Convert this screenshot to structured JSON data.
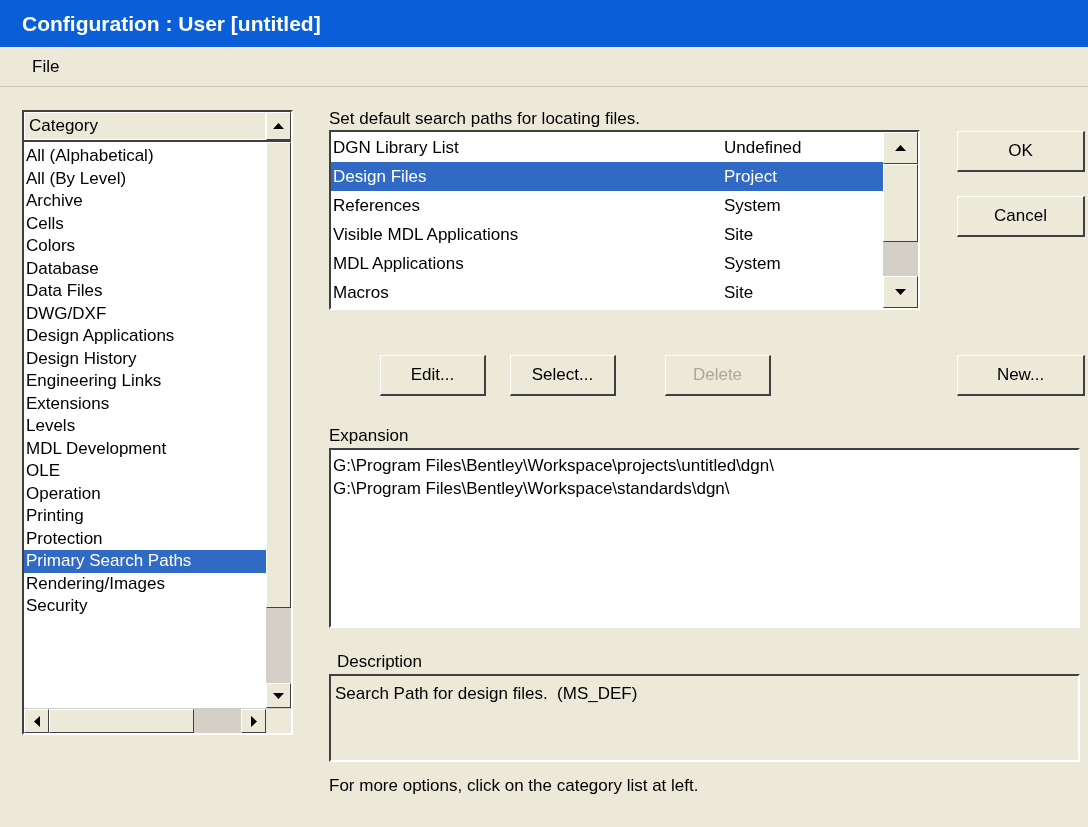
{
  "window": {
    "title": "Configuration : User [untitled]"
  },
  "menu": [
    {
      "label": "File"
    }
  ],
  "category_list": {
    "header": "Category",
    "items": [
      {
        "label": "All (Alphabetical)",
        "selected": false
      },
      {
        "label": "All (By Level)",
        "selected": false
      },
      {
        "label": "Archive",
        "selected": false
      },
      {
        "label": "Cells",
        "selected": false
      },
      {
        "label": "Colors",
        "selected": false
      },
      {
        "label": "Database",
        "selected": false
      },
      {
        "label": "Data Files",
        "selected": false
      },
      {
        "label": "DWG/DXF",
        "selected": false
      },
      {
        "label": "Design Applications",
        "selected": false
      },
      {
        "label": "Design History",
        "selected": false
      },
      {
        "label": "Engineering Links",
        "selected": false
      },
      {
        "label": "Extensions",
        "selected": false
      },
      {
        "label": "Levels",
        "selected": false
      },
      {
        "label": "MDL Development",
        "selected": false
      },
      {
        "label": "OLE",
        "selected": false
      },
      {
        "label": "Operation",
        "selected": false
      },
      {
        "label": "Printing",
        "selected": false
      },
      {
        "label": "Protection",
        "selected": false
      },
      {
        "label": "Primary Search Paths",
        "selected": true
      },
      {
        "label": "Rendering/Images",
        "selected": false
      },
      {
        "label": "Security",
        "selected": false
      }
    ]
  },
  "intro": "Set default search paths for locating files.",
  "variables": [
    {
      "name": "DGN Library List",
      "level": "Undefined",
      "selected": false
    },
    {
      "name": "Design Files",
      "level": "Project",
      "selected": true
    },
    {
      "name": "References",
      "level": "System",
      "selected": false
    },
    {
      "name": "Visible MDL Applications",
      "level": "Site",
      "selected": false
    },
    {
      "name": "MDL Applications",
      "level": "System",
      "selected": false
    },
    {
      "name": "Macros",
      "level": "Site",
      "selected": false
    }
  ],
  "dialog_buttons": [
    {
      "label": "OK",
      "disabled": false
    },
    {
      "label": "Cancel",
      "disabled": false
    }
  ],
  "action_buttons": [
    {
      "label": "Edit...",
      "disabled": false
    },
    {
      "label": "Select...",
      "disabled": false
    },
    {
      "label": "Delete",
      "disabled": true
    }
  ],
  "new_button": {
    "label": "New...",
    "disabled": false
  },
  "expansion": {
    "label": "Expansion",
    "lines": [
      "G:\\Program Files\\Bentley\\Workspace\\projects\\untitled\\dgn\\",
      "G:\\Program Files\\Bentley\\Workspace\\standards\\dgn\\"
    ]
  },
  "description": {
    "label": "Description",
    "text": "Search Path for design files.  (MS_DEF)"
  },
  "footer": "For more options, click on the category list at left."
}
